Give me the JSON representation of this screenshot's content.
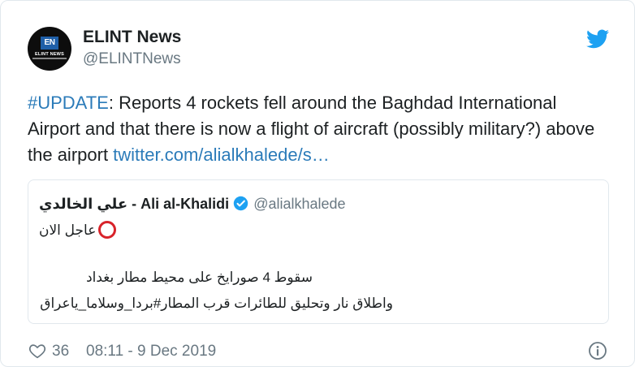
{
  "author": {
    "display_name": "ELINT News",
    "handle": "@ELINTNews",
    "avatar_mark": "EN",
    "avatar_label": "ELINT NEWS"
  },
  "icons": {
    "bird": "twitter-bird-icon",
    "verified": "verified-badge-icon",
    "heart": "heart-icon",
    "info": "info-icon"
  },
  "tweet": {
    "hashtag": "#UPDATE",
    "text": ": Reports 4 rockets fell around the Baghdad International Airport and that there is now a flight of aircraft (possibly military?) above the airport ",
    "link": "twitter.com/alialkhalede/s…"
  },
  "quote": {
    "name": "علي الخالدي - Ali al-Khalidi",
    "handle": "@alialkhalede",
    "line1": "عاجل الان",
    "line2": "سقوط 4 صورايخ على محيط مطار بغداد",
    "line3": "واطلاق نار وتحليق للطائرات قرب المطار#بردا_وسلاما_ياعراق"
  },
  "footer": {
    "likes": "36",
    "timestamp": "08:11 - 9 Dec 2019"
  },
  "colors": {
    "link": "#2b7bb9",
    "muted": "#697882",
    "border": "#e1e8ed",
    "red_circle": "#d8232a"
  }
}
